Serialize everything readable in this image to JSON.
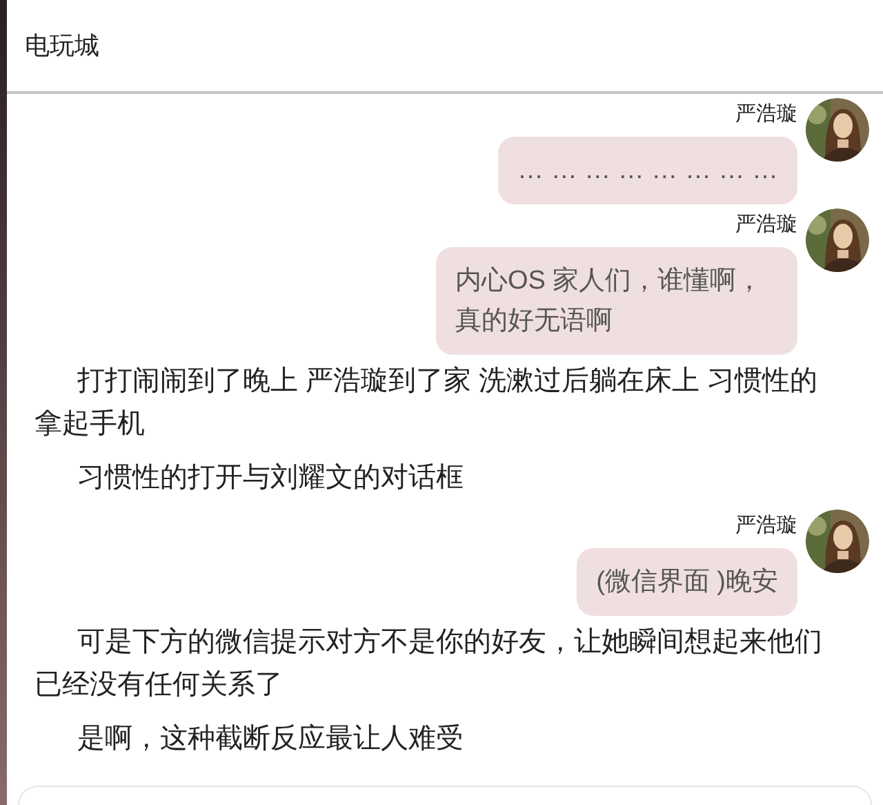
{
  "header": {
    "title": "电玩城"
  },
  "items": [
    {
      "kind": "message",
      "sender": "严浩璇",
      "text": "… … … … … … … …"
    },
    {
      "kind": "message",
      "sender": "严浩璇",
      "text": "内心OS 家人们，谁懂啊，真的好无语啊"
    },
    {
      "kind": "narration",
      "text": "打打闹闹到了晚上 严浩璇到了家 洗漱过后躺在床上 习惯性的拿起手机"
    },
    {
      "kind": "narration",
      "text": "习惯性的打开与刘耀文的对话框"
    },
    {
      "kind": "message",
      "sender": "严浩璇",
      "text": "(微信界面 )晚安"
    },
    {
      "kind": "narration",
      "text": "可是下方的微信提示对方不是你的好友，让她瞬间想起来他们已经没有任何关系了"
    },
    {
      "kind": "narration",
      "text": "是啊，这种截断反应最让人难受"
    }
  ]
}
